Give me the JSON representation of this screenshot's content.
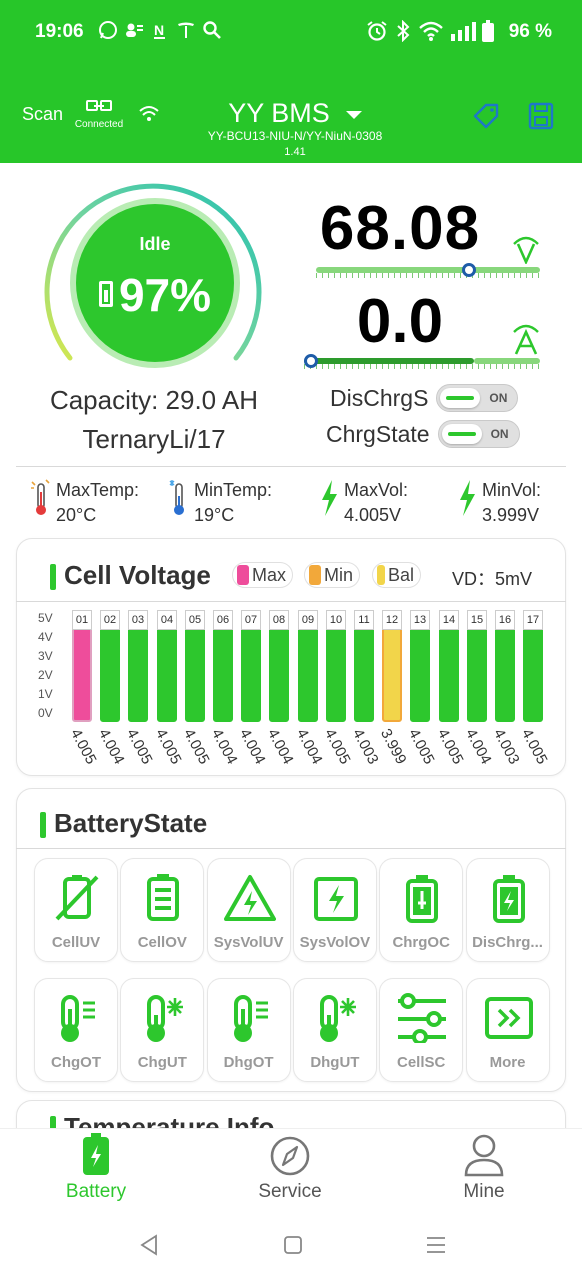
{
  "status_bar": {
    "time": "19:06",
    "battery_pct": "96 %"
  },
  "header": {
    "scan_label": "Scan",
    "connected_label": "Connected",
    "title": "YY BMS",
    "device": "YY-BCU13-NIU-N/YY-NiuN-0308",
    "version": "1.41"
  },
  "gauge": {
    "state": "Idle",
    "soc": "97%",
    "soc_fraction": 0.97
  },
  "capacity": "Capacity: 29.0 AH",
  "chemistry": "TernaryLi/17",
  "voltage": {
    "value": "68.08",
    "unit": "V"
  },
  "current": {
    "value": "0.0",
    "unit": "A"
  },
  "switches": [
    {
      "label": "DisChrgS",
      "state": "ON"
    },
    {
      "label": "ChrgState",
      "state": "ON"
    }
  ],
  "stats": [
    {
      "label": "MaxTemp:",
      "value": "20°C"
    },
    {
      "label": "MinTemp:",
      "value": "19°C"
    },
    {
      "label": "MaxVol:",
      "value": "4.005V"
    },
    {
      "label": "MinVol:",
      "value": "3.999V"
    }
  ],
  "cell_voltage": {
    "title": "Cell Voltage",
    "legend": [
      "Max",
      "Min",
      "Bal"
    ],
    "vd_label": "VD：",
    "vd_value": "5mV",
    "yaxis": [
      "5V",
      "4V",
      "3V",
      "2V",
      "1V",
      "0V"
    ],
    "cells": [
      {
        "id": "01",
        "v": "4.005",
        "tag": "max"
      },
      {
        "id": "02",
        "v": "4.004",
        "tag": ""
      },
      {
        "id": "03",
        "v": "4.005",
        "tag": ""
      },
      {
        "id": "04",
        "v": "4.005",
        "tag": ""
      },
      {
        "id": "05",
        "v": "4.005",
        "tag": ""
      },
      {
        "id": "06",
        "v": "4.004",
        "tag": ""
      },
      {
        "id": "07",
        "v": "4.004",
        "tag": ""
      },
      {
        "id": "08",
        "v": "4.004",
        "tag": ""
      },
      {
        "id": "09",
        "v": "4.004",
        "tag": ""
      },
      {
        "id": "10",
        "v": "4.005",
        "tag": ""
      },
      {
        "id": "11",
        "v": "4.003",
        "tag": ""
      },
      {
        "id": "12",
        "v": "3.999",
        "tag": "min"
      },
      {
        "id": "13",
        "v": "4.005",
        "tag": ""
      },
      {
        "id": "14",
        "v": "4.005",
        "tag": ""
      },
      {
        "id": "15",
        "v": "4.004",
        "tag": ""
      },
      {
        "id": "16",
        "v": "4.003",
        "tag": ""
      },
      {
        "id": "17",
        "v": "4.005",
        "tag": ""
      }
    ]
  },
  "battery_state": {
    "title": "BatteryState",
    "items": [
      {
        "label": "CellUV",
        "icon": "cell-undervoltage-icon"
      },
      {
        "label": "CellOV",
        "icon": "cell-overvoltage-icon"
      },
      {
        "label": "SysVolUV",
        "icon": "system-undervoltage-icon"
      },
      {
        "label": "SysVolOV",
        "icon": "system-overvoltage-icon"
      },
      {
        "label": "ChrgOC",
        "icon": "charge-overcurrent-icon"
      },
      {
        "label": "DisChrg...",
        "icon": "discharge-overcurrent-icon"
      },
      {
        "label": "ChgOT",
        "icon": "charge-overtemp-icon"
      },
      {
        "label": "ChgUT",
        "icon": "charge-undertemp-icon"
      },
      {
        "label": "DhgOT",
        "icon": "discharge-overtemp-icon"
      },
      {
        "label": "DhgUT",
        "icon": "discharge-undertemp-icon"
      },
      {
        "label": "CellSC",
        "icon": "cell-short-circuit-icon"
      },
      {
        "label": "More",
        "icon": "more-icon"
      }
    ]
  },
  "next_section_title": "Temperature Info",
  "nav": [
    {
      "label": "Battery",
      "active": true
    },
    {
      "label": "Service",
      "active": false
    },
    {
      "label": "Mine",
      "active": false
    }
  ],
  "colors": {
    "accent": "#27c629",
    "max": "#ee4d9b",
    "min": "#f2d54a",
    "text": "#333333"
  }
}
